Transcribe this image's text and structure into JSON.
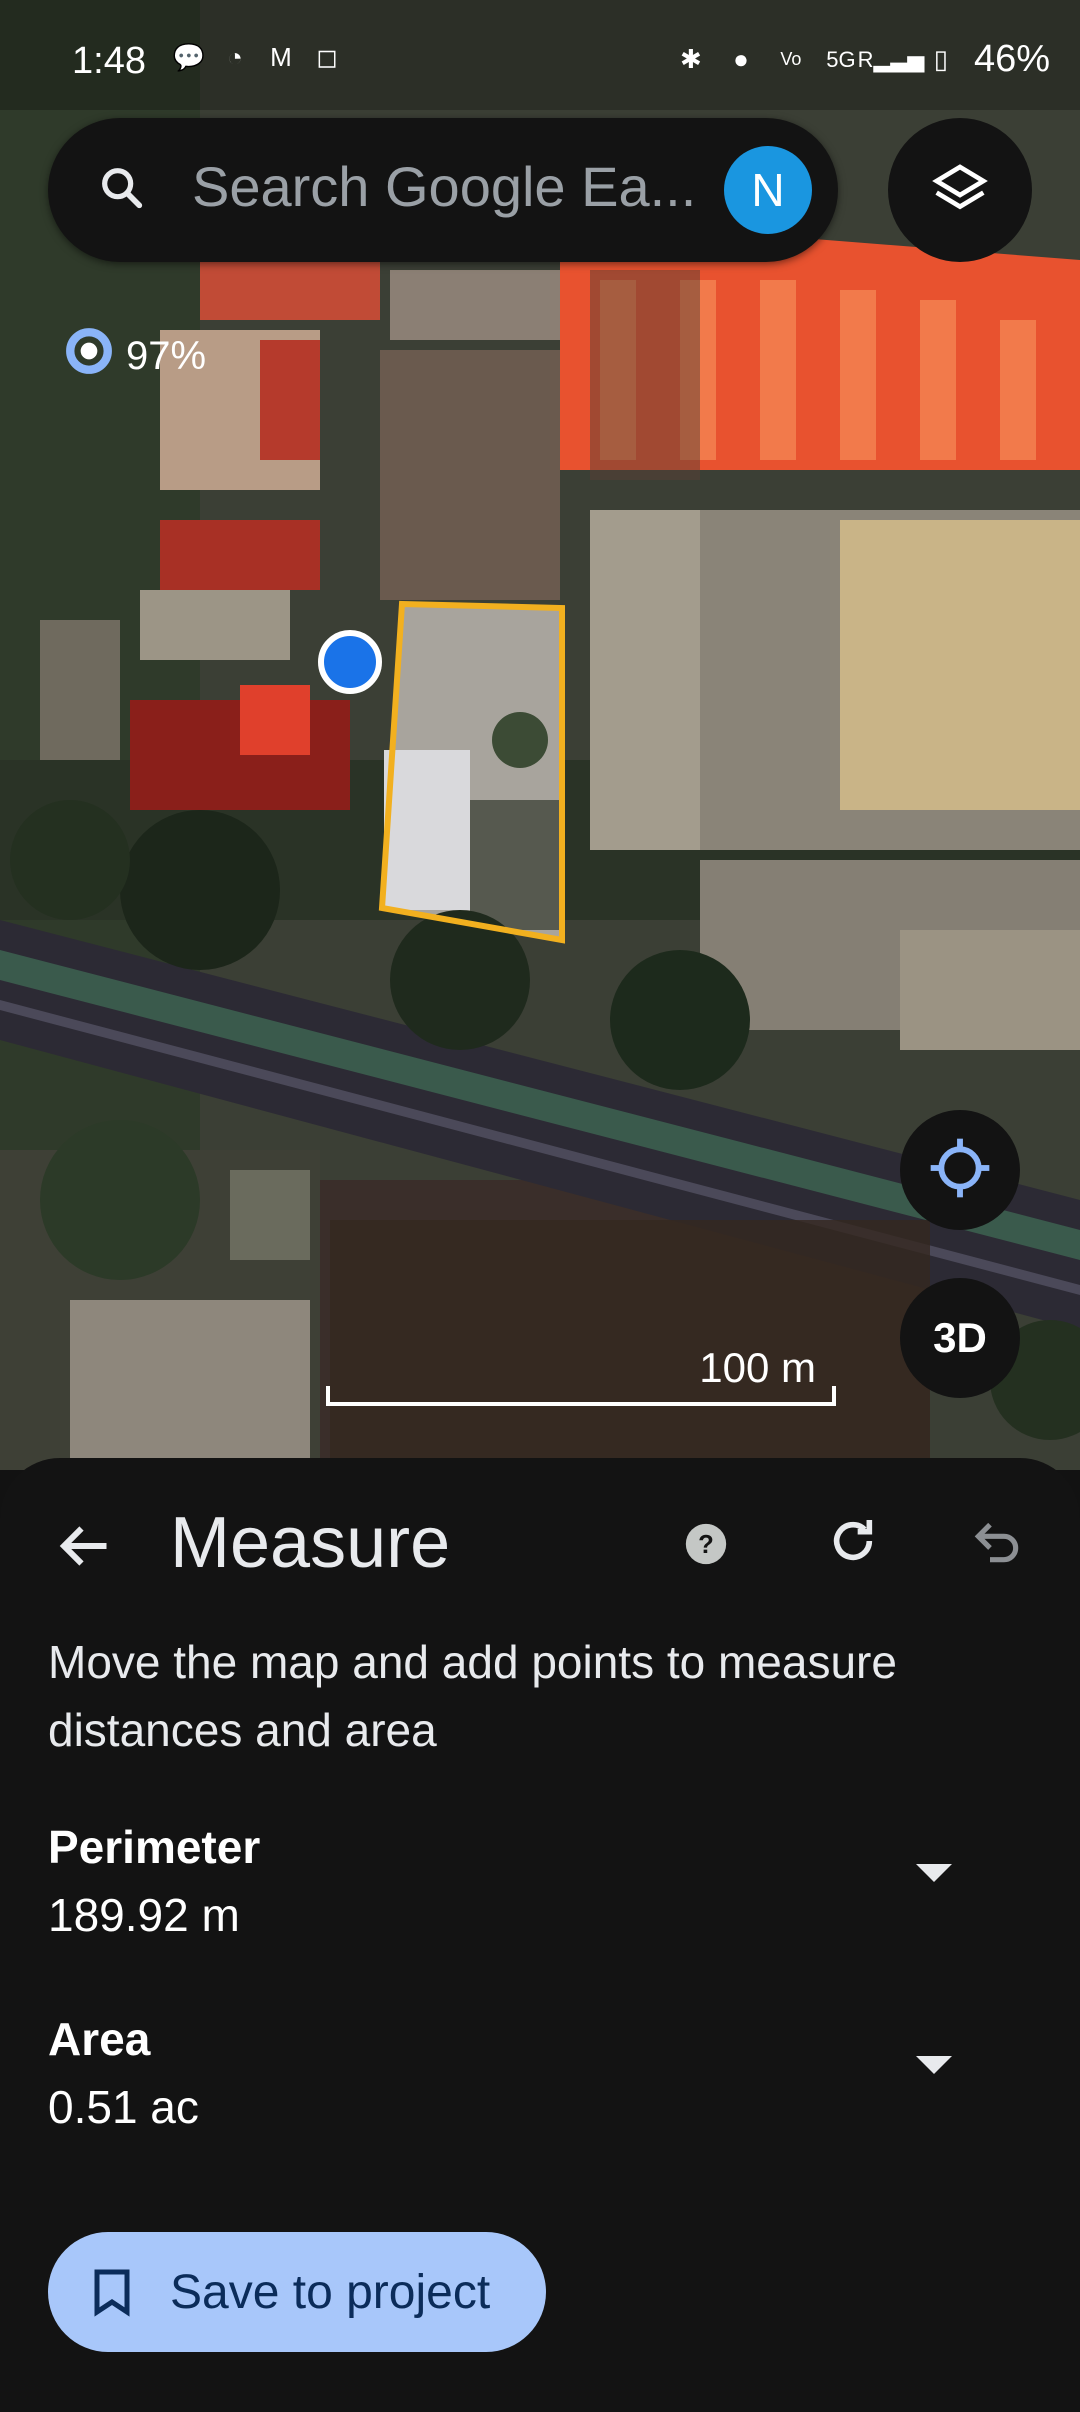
{
  "status_bar": {
    "time": "1:48",
    "battery": "46%",
    "network": "5G",
    "volte": "VoLTE2",
    "roaming": "R"
  },
  "search": {
    "placeholder": "Search Google Ea...",
    "avatar_letter": "N"
  },
  "map": {
    "loading_percent": "97%",
    "scale_label": "100 m",
    "view_3d_label": "3D"
  },
  "measure": {
    "title": "Measure",
    "instructions": "Move the map and add points to measure distances and area",
    "perimeter": {
      "label": "Perimeter",
      "value": "189.92 m"
    },
    "area": {
      "label": "Area",
      "value": "0.51 ac"
    },
    "save_label": "Save to project"
  },
  "colors": {
    "accent": "#a8c7fa",
    "polygon": "#f2b01f",
    "avatar": "#1a96e0",
    "location": "#1a73e8"
  },
  "icons": [
    "search-icon",
    "layers-icon",
    "my-location-icon",
    "back-arrow-icon",
    "help-icon",
    "refresh-icon",
    "undo-icon",
    "bookmark-icon",
    "bluetooth-icon",
    "location-icon",
    "battery-icon"
  ]
}
